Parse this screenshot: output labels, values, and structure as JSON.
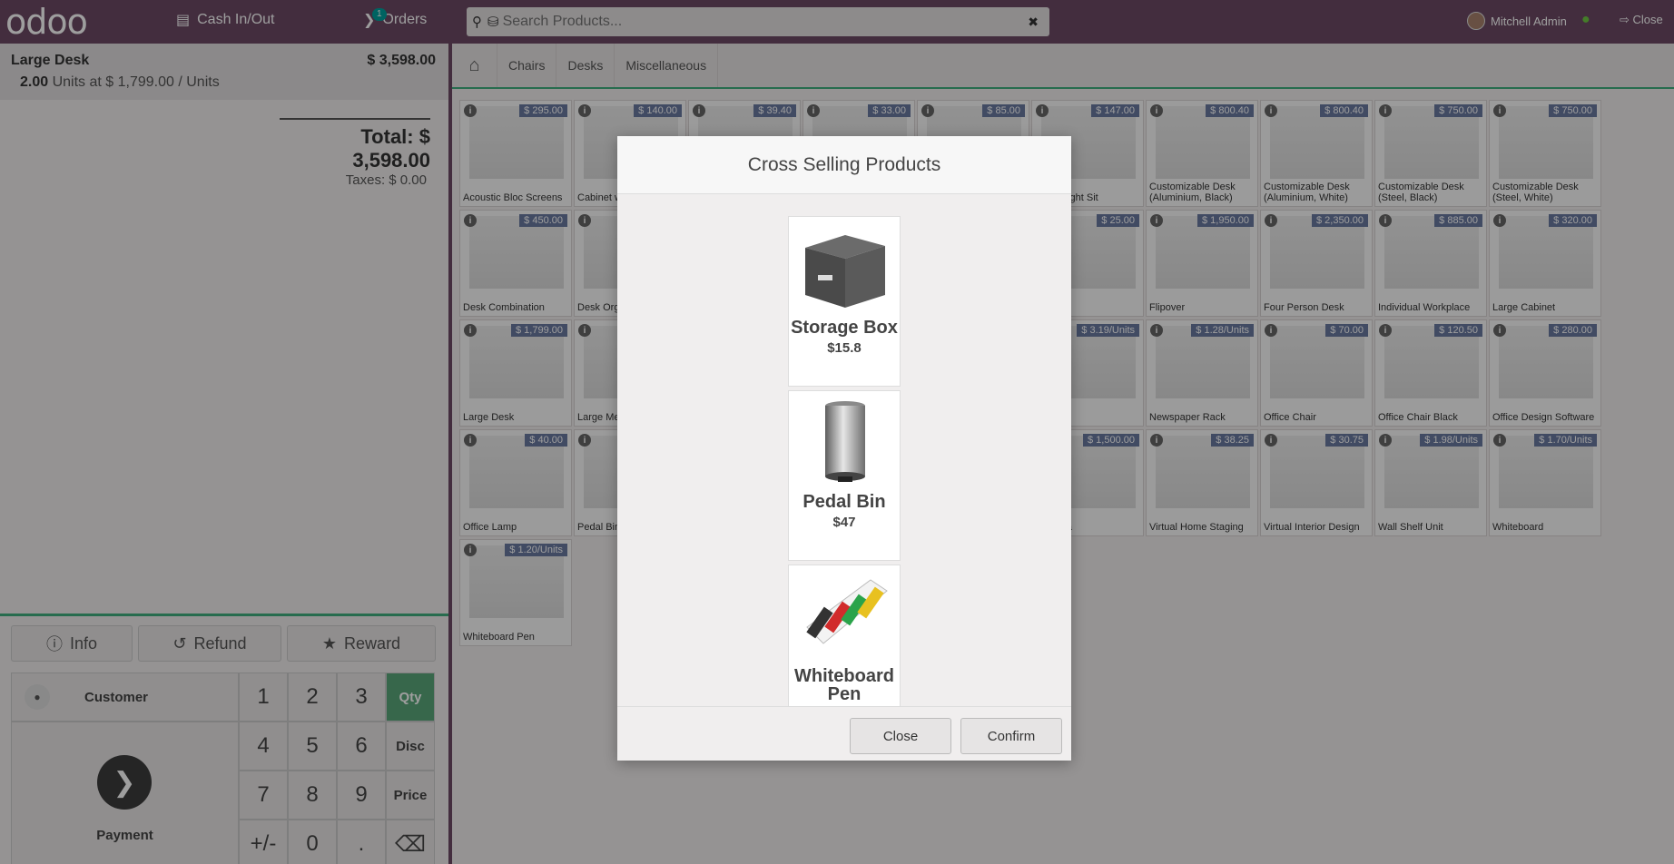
{
  "header": {
    "logo": "odoo",
    "cash_in_out": "Cash In/Out",
    "orders": "Orders",
    "orders_badge": "1",
    "search_placeholder": "Search Products...",
    "user_name": "Mitchell Admin",
    "close": "Close"
  },
  "order": {
    "lines": [
      {
        "name": "Large Desk",
        "price": "$ 3,598.00",
        "qty": "2.00",
        "unit_desc": "Units at $ 1,799.00 / Units"
      }
    ],
    "total_label": "Total:",
    "total": "$ 3,598.00",
    "taxes": "Taxes: $ 0.00"
  },
  "controls": {
    "info": "Info",
    "refund": "Refund",
    "reward": "Reward",
    "customer": "Customer",
    "payment": "Payment",
    "keys": [
      "1",
      "2",
      "3",
      "Qty",
      "4",
      "5",
      "6",
      "Disc",
      "7",
      "8",
      "9",
      "Price",
      "+/-",
      "0",
      "."
    ]
  },
  "categories": [
    "Chairs",
    "Desks",
    "Miscellaneous"
  ],
  "products": [
    {
      "name": "Acoustic Bloc Screens",
      "price": "$ 295.00"
    },
    {
      "name": "Cabinet with Doors",
      "price": "$ 140.00"
    },
    {
      "name": "",
      "price": "$ 39.40"
    },
    {
      "name": "",
      "price": "$ 33.00"
    },
    {
      "name": "",
      "price": "$ 85.00"
    },
    {
      "name": "Desk Right Sit",
      "price": "$ 147.00"
    },
    {
      "name": "Customizable Desk (Aluminium, Black)",
      "price": "$ 800.40"
    },
    {
      "name": "Customizable Desk (Aluminium, White)",
      "price": "$ 800.40"
    },
    {
      "name": "Customizable Desk (Steel, Black)",
      "price": "$ 750.00"
    },
    {
      "name": "Customizable Desk (Steel, White)",
      "price": "$ 750.00"
    },
    {
      "name": "Desk Combination",
      "price": "$ 450.00"
    },
    {
      "name": "Desk Organizer",
      "price": ""
    },
    {
      "name": "",
      "price": ""
    },
    {
      "name": "",
      "price": ""
    },
    {
      "name": "",
      "price": ""
    },
    {
      "name": "Black",
      "price": "$ 25.00"
    },
    {
      "name": "Flipover",
      "price": "$ 1,950.00"
    },
    {
      "name": "Four Person Desk",
      "price": "$ 2,350.00"
    },
    {
      "name": "Individual Workplace",
      "price": "$ 885.00"
    },
    {
      "name": "Large Cabinet",
      "price": "$ 320.00"
    },
    {
      "name": "Large Desk",
      "price": "$ 1,799.00"
    },
    {
      "name": "Large Meeting Table",
      "price": ""
    },
    {
      "name": "",
      "price": ""
    },
    {
      "name": "",
      "price": ""
    },
    {
      "name": "",
      "price": ""
    },
    {
      "name": "Stand",
      "price": "$ 3.19/Units"
    },
    {
      "name": "Newspaper Rack",
      "price": "$ 1.28/Units"
    },
    {
      "name": "Office Chair",
      "price": "$ 70.00"
    },
    {
      "name": "Office Chair Black",
      "price": "$ 120.50"
    },
    {
      "name": "Office Design Software",
      "price": "$ 280.00"
    },
    {
      "name": "Office Lamp",
      "price": "$ 40.00"
    },
    {
      "name": "Pedal Bin",
      "price": ""
    },
    {
      "name": "",
      "price": ""
    },
    {
      "name": "",
      "price": ""
    },
    {
      "name": "",
      "price": ""
    },
    {
      "name": "eat Sofa",
      "price": "$ 1,500.00"
    },
    {
      "name": "Virtual Home Staging",
      "price": "$ 38.25"
    },
    {
      "name": "Virtual Interior Design",
      "price": "$ 30.75"
    },
    {
      "name": "Wall Shelf Unit",
      "price": "$ 1.98/Units"
    },
    {
      "name": "Whiteboard",
      "price": "$ 1.70/Units"
    },
    {
      "name": "Whiteboard Pen",
      "price": "$ 1.20/Units"
    }
  ],
  "modal": {
    "title": "Cross Selling Products",
    "items": [
      {
        "name": "Storage Box",
        "price": "$15.8"
      },
      {
        "name": "Pedal Bin",
        "price": "$47"
      },
      {
        "name": "Whiteboard Pen",
        "price": ""
      }
    ],
    "close": "Close",
    "confirm": "Confirm"
  },
  "colors": {
    "header": "#6c4a65",
    "accent_green": "#3fae7e",
    "price_tag": "#6a79a0"
  }
}
